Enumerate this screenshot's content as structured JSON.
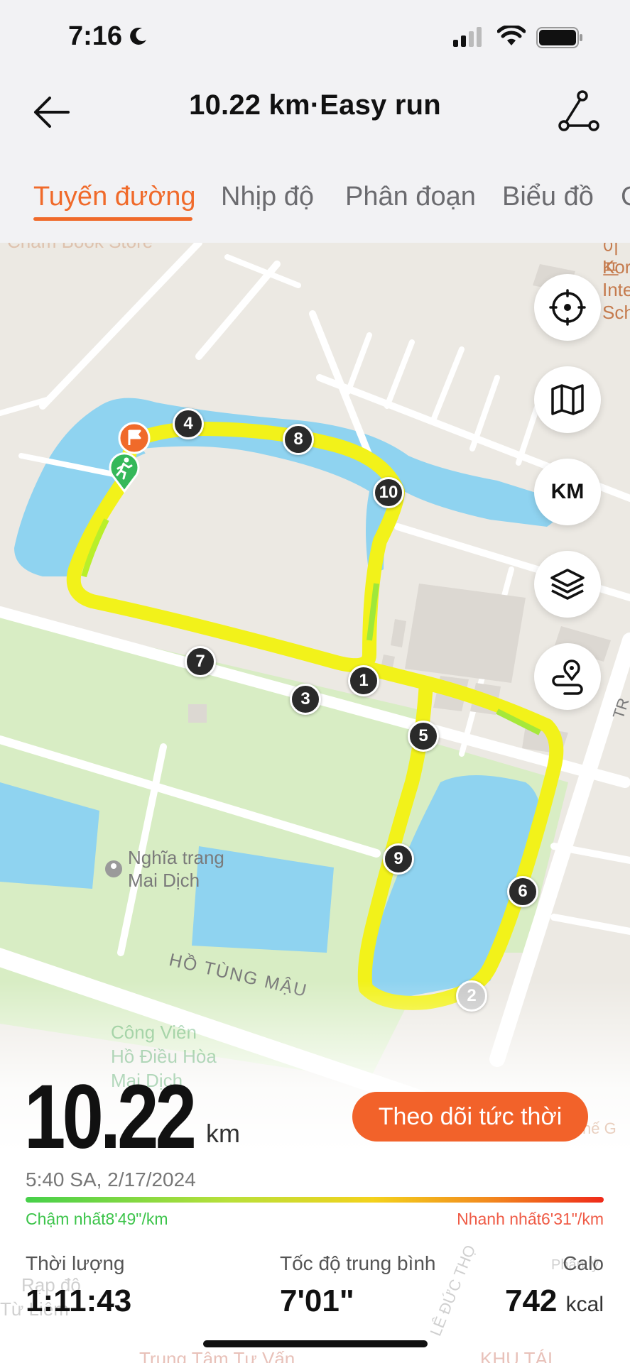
{
  "status_bar": {
    "time": "7:16"
  },
  "header": {
    "title": "10.22 km·Easy run"
  },
  "tabs": [
    {
      "label": "Tuyến đường"
    },
    {
      "label": "Nhịp độ"
    },
    {
      "label": "Phân đoạn"
    },
    {
      "label": "Biểu đồ"
    },
    {
      "label": "G"
    }
  ],
  "map": {
    "labels": {
      "top_left_store": "Cham Book Store",
      "school_line1": "Kor",
      "school_line2": "Inte",
      "school_line3": "Sch",
      "top_right_small": "이프",
      "cemetery_line1": "Nghĩa trang",
      "cemetery_line2": "Mai Dịch",
      "street_ho_tung_mau": "HỒ TÙNG MẬU",
      "park_line1": "Công Viên",
      "park_line2": "Hồ Điều Hòa",
      "park_line3": "Mai Dịch",
      "right_edge_street": "TR",
      "street_le_duc_tho": "LÊ ĐỨC THỌ",
      "bottom_left_1": "Rạp độ",
      "bottom_left_2": "Từ Liêm",
      "bottom_center": "Trung Tâm Tư Vấn",
      "bottom_right": "KHU TÁI",
      "right_small": "Phân lý",
      "right_green": "hế G"
    },
    "km_markers": [
      "1",
      "2",
      "3",
      "4",
      "5",
      "6",
      "7",
      "8",
      "9",
      "10"
    ],
    "fab": {
      "km_label": "KM"
    },
    "icons": [
      "locate-icon",
      "map-icon",
      "layers-icon",
      "route-pin-icon",
      "start-runner-icon",
      "finish-flag-icon"
    ]
  },
  "stats": {
    "distance": "10.22",
    "distance_unit": "km",
    "live_button": "Theo dõi tức thời",
    "date": "5:40 SA, 2/17/2024",
    "slowest_label": "Chậm nhất",
    "slowest_value": "8'49\"/km",
    "fastest_label": "Nhanh nhất",
    "fastest_value": "6'31\"/km",
    "duration_label": "Thời lượng",
    "duration_value": "1:11:43",
    "avg_pace_label": "Tốc độ trung bình",
    "avg_pace_value": "7'01\"",
    "calories_label": "Calo",
    "calories_value": "742",
    "calories_unit": "kcal"
  },
  "colors": {
    "accent": "#f06a2a",
    "route": "#f2f21a",
    "water": "#8fd3f0",
    "park": "#d6ecc0",
    "fast": "#ef2a1a",
    "slow": "#46d04a"
  }
}
